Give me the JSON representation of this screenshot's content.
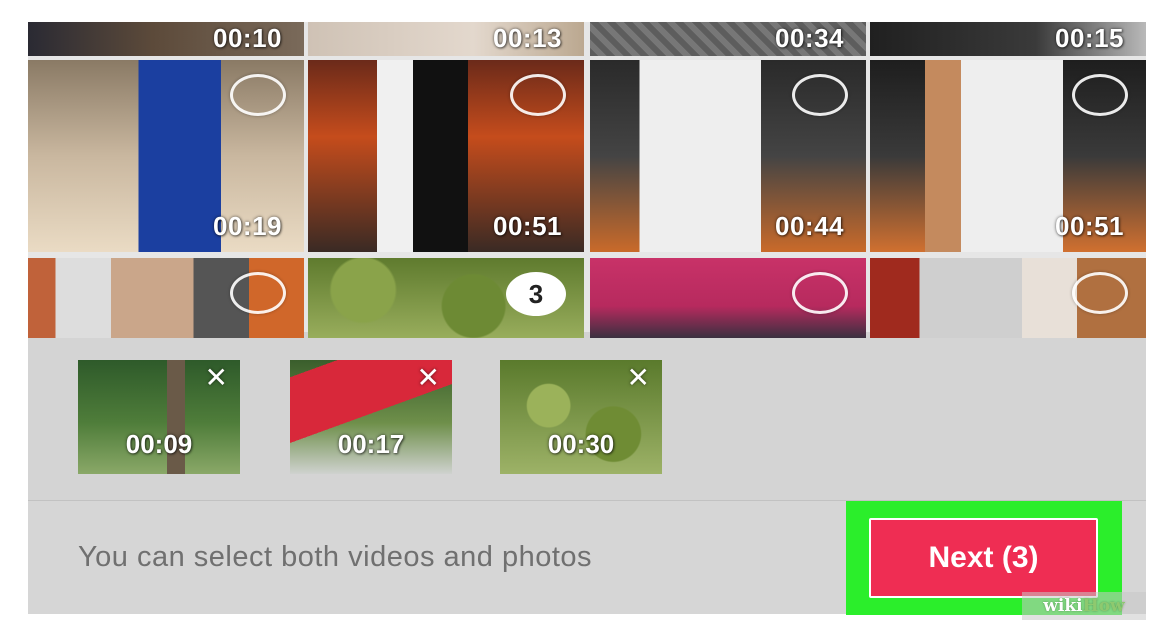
{
  "gallery": {
    "row0": [
      {
        "duration": "00:10"
      },
      {
        "duration": "00:13"
      },
      {
        "duration": "00:34"
      },
      {
        "duration": "00:15"
      }
    ],
    "row1": [
      {
        "duration": "00:19"
      },
      {
        "duration": "00:51"
      },
      {
        "duration": "00:44"
      },
      {
        "duration": "00:51"
      }
    ],
    "row2": [
      {
        "selected": false
      },
      {
        "selected": true,
        "order": "3"
      },
      {
        "selected": false
      },
      {
        "selected": false
      }
    ]
  },
  "tray": {
    "clips": [
      {
        "duration": "00:09",
        "remove_icon": "close-icon"
      },
      {
        "duration": "00:17",
        "remove_icon": "close-icon"
      },
      {
        "duration": "00:30",
        "remove_icon": "close-icon"
      }
    ],
    "remove_glyph": "✕"
  },
  "footer": {
    "hint": "You can select both videos and photos",
    "next_label": "Next (3)"
  },
  "watermark": {
    "wiki": "wiki",
    "how": "How"
  },
  "colors": {
    "accent": "#ef2d53",
    "highlight": "#2bee2b",
    "background": "#d4d4d4"
  }
}
